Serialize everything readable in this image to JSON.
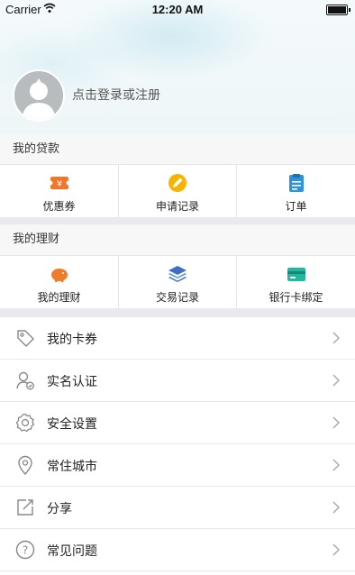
{
  "status_bar": {
    "carrier": "Carrier",
    "time": "12:20 AM"
  },
  "profile": {
    "login_prompt": "点击登录或注册"
  },
  "loans": {
    "title": "我的贷款",
    "items": [
      {
        "label": "优惠券",
        "icon": "coupon-icon"
      },
      {
        "label": "申请记录",
        "icon": "pen-icon"
      },
      {
        "label": "订单",
        "icon": "clipboard-icon"
      }
    ]
  },
  "finance": {
    "title": "我的理财",
    "items": [
      {
        "label": "我的理财",
        "icon": "piggy-bank-icon"
      },
      {
        "label": "交易记录",
        "icon": "layers-icon"
      },
      {
        "label": "银行卡绑定",
        "icon": "bank-card-icon"
      }
    ]
  },
  "menu": {
    "items": [
      {
        "label": "我的卡券",
        "icon": "tag-icon"
      },
      {
        "label": "实名认证",
        "icon": "verified-user-icon"
      },
      {
        "label": "安全设置",
        "icon": "gear-icon"
      },
      {
        "label": "常住城市",
        "icon": "location-pin-icon"
      },
      {
        "label": "分享",
        "icon": "share-icon"
      },
      {
        "label": "常见问题",
        "icon": "help-icon"
      }
    ]
  },
  "colors": {
    "coupon": "#f0762a",
    "pen": "#f5b400",
    "clipboard": "#2f93d8",
    "piggy": "#f07b2a",
    "layers": "#3d6fc4",
    "card": "#22b8a0"
  }
}
